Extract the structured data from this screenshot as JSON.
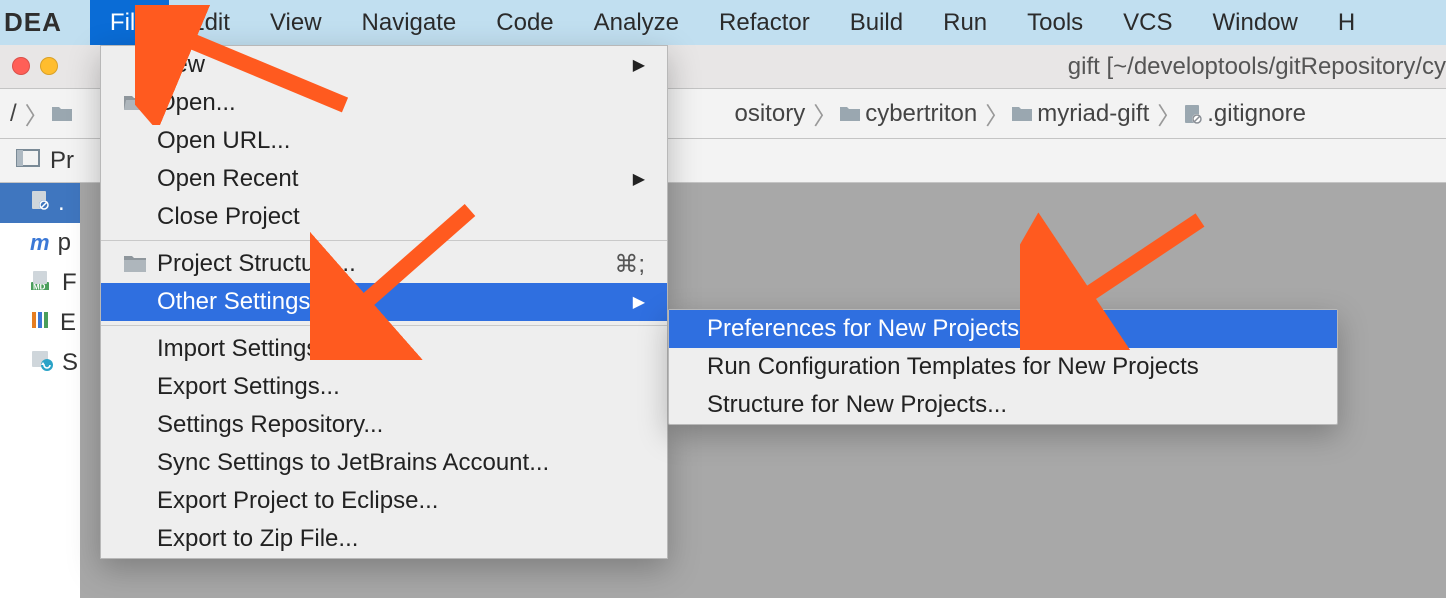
{
  "logo": "DEA",
  "menubar": {
    "items": [
      {
        "label": "File",
        "active": true
      },
      {
        "label": "Edit"
      },
      {
        "label": "View"
      },
      {
        "label": "Navigate"
      },
      {
        "label": "Code"
      },
      {
        "label": "Analyze"
      },
      {
        "label": "Refactor"
      },
      {
        "label": "Build"
      },
      {
        "label": "Run"
      },
      {
        "label": "Tools"
      },
      {
        "label": "VCS"
      },
      {
        "label": "Window"
      },
      {
        "label": "H"
      }
    ]
  },
  "titlebar": "gift [~/developtools/gitRepository/cy",
  "breadcrumb": {
    "root": "/",
    "items": [
      {
        "label": "ository"
      },
      {
        "label": "cybertriton"
      },
      {
        "label": "myriad-gift"
      },
      {
        "label": ".gitignore"
      }
    ]
  },
  "tooltab": "Pr",
  "tree": {
    "items": [
      {
        "label": ".",
        "icon": "gitignore",
        "selected": true
      },
      {
        "label": "p",
        "icon": "m"
      },
      {
        "label": "F",
        "icon": "md"
      },
      {
        "label": "E",
        "icon": "bars"
      },
      {
        "label": "S",
        "icon": "ps"
      }
    ]
  },
  "file_menu": {
    "new": "New",
    "open": "Open...",
    "open_url": "Open URL...",
    "open_recent": "Open Recent",
    "close_project": "Close Project",
    "project_structure": "Project Structure...",
    "project_structure_shortcut": "⌘;",
    "other_settings": "Other Settings",
    "import_settings": "Import Settings...",
    "export_settings": "Export Settings...",
    "settings_repository": "Settings Repository...",
    "sync_settings": "Sync Settings to JetBrains Account...",
    "export_eclipse": "Export Project to Eclipse...",
    "export_zip": "Export to Zip File..."
  },
  "submenu": {
    "pref_new": "Preferences for New Projects...",
    "run_conf": "Run Configuration Templates for New Projects",
    "structure_new": "Structure for New Projects..."
  }
}
